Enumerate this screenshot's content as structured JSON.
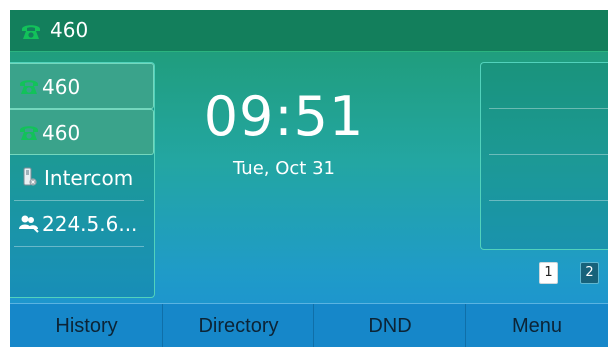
{
  "header": {
    "account": "460",
    "icon": "phone-icon"
  },
  "lines": [
    {
      "label": "460",
      "icon": "phone-icon",
      "active": true
    },
    {
      "label": "460",
      "icon": "phone-icon",
      "active": true
    },
    {
      "label": "Intercom",
      "icon": "intercom-icon",
      "active": false
    },
    {
      "label": "224.5.6...",
      "icon": "multicast-group-icon",
      "active": false
    },
    {
      "label": "",
      "icon": "",
      "active": false
    }
  ],
  "clock": {
    "time": "09:51",
    "date": "Tue, Oct 31"
  },
  "pages": {
    "current": "1",
    "next": "2"
  },
  "softkeys": [
    "History",
    "Directory",
    "DND",
    "Menu"
  ],
  "colors": {
    "phone_icon": "#12c25a",
    "topbar": "#137f5c",
    "softbar": "#1687c9"
  }
}
